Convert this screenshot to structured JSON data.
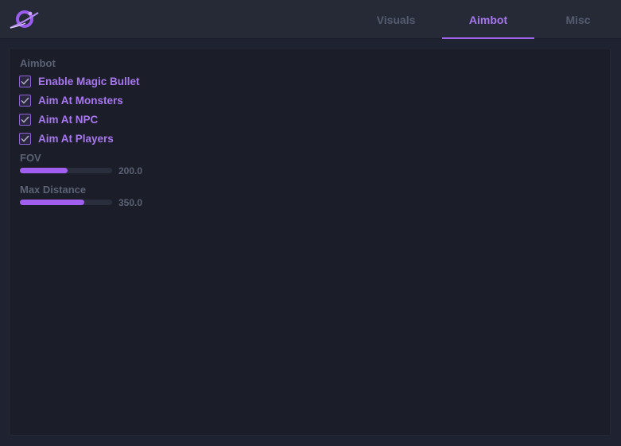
{
  "tabs": [
    {
      "label": "Visuals",
      "active": false
    },
    {
      "label": "Aimbot",
      "active": true
    },
    {
      "label": "Misc",
      "active": false
    }
  ],
  "aimbot": {
    "section_title": "Aimbot",
    "checkboxes": [
      {
        "label": "Enable Magic Bullet",
        "checked": true
      },
      {
        "label": "Aim At Monsters",
        "checked": true
      },
      {
        "label": "Aim At NPC",
        "checked": true
      },
      {
        "label": "Aim At Players",
        "checked": true
      }
    ],
    "sliders": [
      {
        "label": "FOV",
        "value": "200.0",
        "fill_fraction": 0.52
      },
      {
        "label": "Max Distance",
        "value": "350.0",
        "fill_fraction": 0.7
      }
    ]
  },
  "colors": {
    "accent": "#a877f0",
    "slider_fill": "#a15ff0",
    "background": "#1f2230",
    "panel": "#1b1e29",
    "muted_text": "#5b6275"
  },
  "icons": {
    "logo": "planet-logo-icon",
    "checkbox": "checkmark-icon"
  }
}
